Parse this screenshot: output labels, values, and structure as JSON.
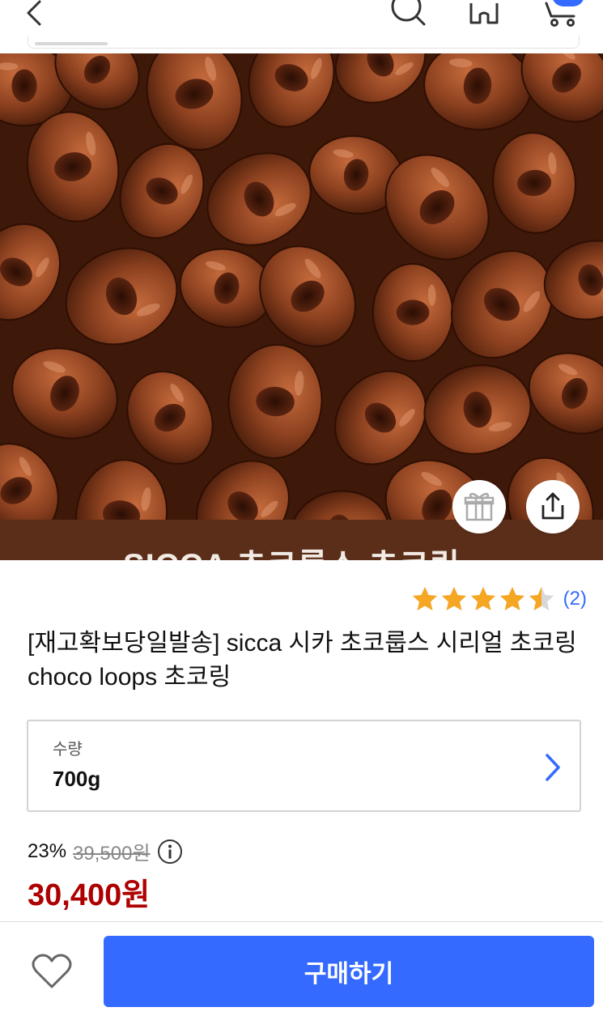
{
  "product": {
    "banner_text": "SICCA 초코룹스 초코링",
    "title": "[재고확보당일발송] sicca 시카 초코룹스 시리얼 초코링 choco loops 초코링",
    "rating": 4.5,
    "review_count": "(2)"
  },
  "option": {
    "label": "수량",
    "value": "700g"
  },
  "price": {
    "discount_rate": "23%",
    "original": "39,500원",
    "sale": "30,400원"
  },
  "actions": {
    "buy_label": "구매하기"
  },
  "icons": {
    "back": "chevron-left-icon",
    "search": "search-icon",
    "home": "home-icon",
    "cart": "cart-icon",
    "gift": "gift-icon",
    "share": "share-icon",
    "info": "info-icon",
    "wishlist": "heart-icon"
  },
  "colors": {
    "accent": "#346aff",
    "sale_price": "#ae0000",
    "star": "#f5a623"
  }
}
